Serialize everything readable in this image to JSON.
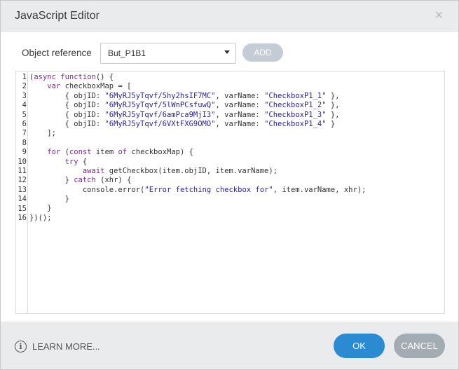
{
  "dialog": {
    "title": "JavaScript Editor",
    "close_icon": "×"
  },
  "object_reference": {
    "label": "Object reference",
    "selected": "But_P1B1",
    "add_label": "ADD"
  },
  "editor": {
    "line_numbers": [
      "1",
      "2",
      "3",
      "4",
      "5",
      "6",
      "7",
      "8",
      "9",
      "10",
      "11",
      "12",
      "13",
      "14",
      "15",
      "16"
    ],
    "lines": [
      "(async function() {",
      "    var checkboxMap = [",
      "        { objID: \"6MyRJ5yTqvf/5hy2hsIF7MC\", varName: \"CheckboxP1_1\" },",
      "        { objID: \"6MyRJ5yTqvf/5lWnPCsfuwQ\", varName: \"CheckboxP1_2\" },",
      "        { objID: \"6MyRJ5yTqvf/6amPca9MjI3\", varName: \"CheckboxP1_3\" },",
      "        { objID: \"6MyRJ5yTqvf/6VXtFXG9OMO\", varName: \"CheckboxP1_4\" }",
      "    ];",
      "",
      "    for (const item of checkboxMap) {",
      "        try {",
      "            await getCheckbox(item.objID, item.varName);",
      "        } catch (xhr) {",
      "            console.error(\"Error fetching checkbox for\", item.varName, xhr);",
      "        }",
      "    }",
      "})();"
    ]
  },
  "footer": {
    "learn_more": "LEARN MORE...",
    "info_icon": "info-icon",
    "ok_label": "OK",
    "cancel_label": "CANCEL"
  },
  "colors": {
    "header_bg": "#e9ebed",
    "ok_bg": "#2a8ad2",
    "cancel_bg": "#a3abb3",
    "add_bg": "#c4ccd5",
    "keyword": "#7a2a8c",
    "string": "#2a1ea0"
  }
}
